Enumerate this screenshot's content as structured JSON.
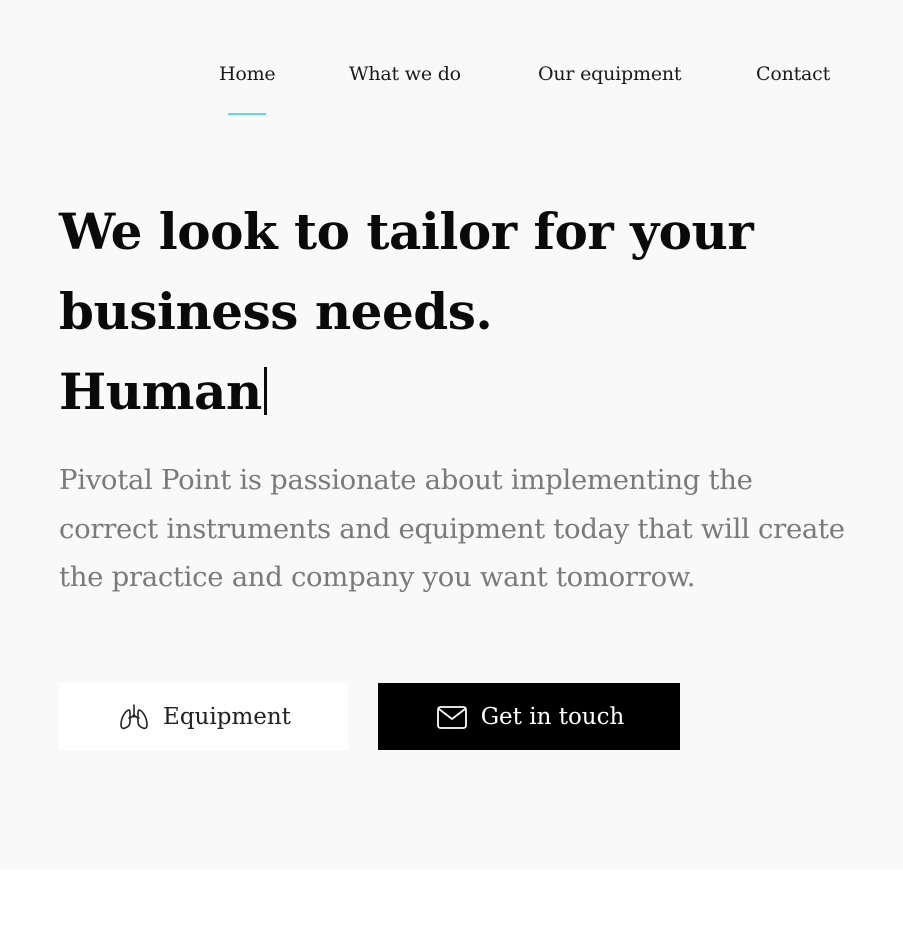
{
  "nav": {
    "items": [
      {
        "label": "Home",
        "active": true
      },
      {
        "label": "What we do",
        "active": false
      },
      {
        "label": "Our equipment",
        "active": false
      },
      {
        "label": "Contact",
        "active": false
      }
    ],
    "active_indicator_color": "#5fd7ea"
  },
  "hero": {
    "headline_line1": "We look to tailor for your",
    "headline_line2": "business needs.",
    "typed_word": "Human",
    "intro": "Pivotal Point is passionate about implementing the correct instruments and equipment today that will create the practice and company you want tomorrow.",
    "background": "#f9f9f9"
  },
  "buttons": {
    "equipment": {
      "label": "Equipment",
      "icon": "lungs-icon"
    },
    "contact": {
      "label": "Get in touch",
      "icon": "mail-icon"
    }
  }
}
